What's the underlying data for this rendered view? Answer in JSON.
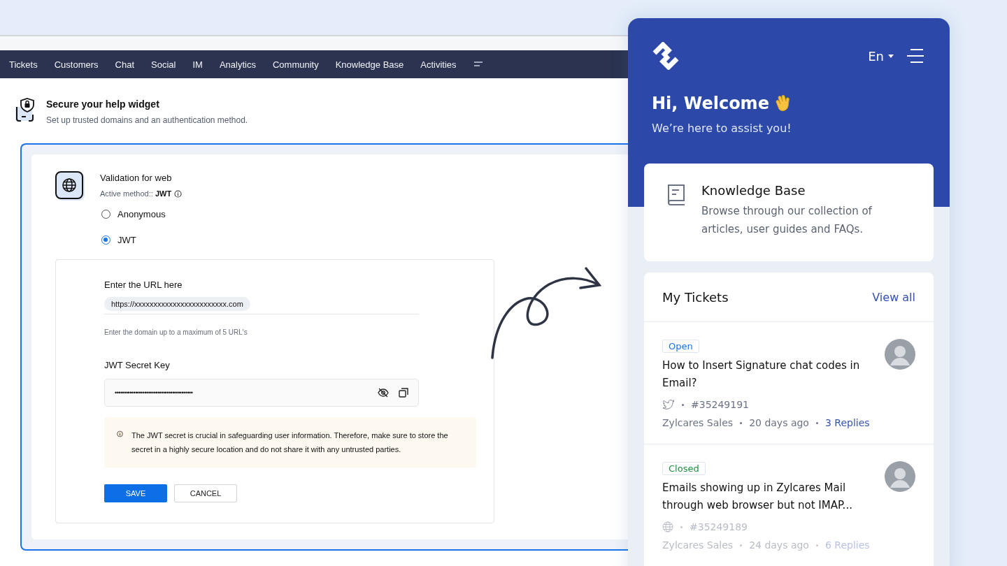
{
  "nav": {
    "items": [
      {
        "label": "Tickets"
      },
      {
        "label": "Customers"
      },
      {
        "label": "Chat"
      },
      {
        "label": "Social"
      },
      {
        "label": "IM"
      },
      {
        "label": "Analytics"
      },
      {
        "label": "Community"
      },
      {
        "label": "Knowledge Base"
      },
      {
        "label": "Activities"
      }
    ]
  },
  "header": {
    "title": "Secure your help widget",
    "subtitle": "Set up trusted domains and an authentication method."
  },
  "validation": {
    "title": "Validation for web",
    "active_method": "Active method:: **JWT**",
    "options": [
      {
        "label": "Anonymous",
        "selected": false
      },
      {
        "label": "JWT",
        "selected": true
      }
    ],
    "url_field": {
      "label": "Enter the URL here",
      "value": "https://xxxxxxxxxxxxxxxxxxxxxxxx.com",
      "hint": "Enter the domain up to a maximum of 5 URL's"
    },
    "secret_field": {
      "label": "JWT Secret Key",
      "value": "••••••••••••••••••••••••••••••••••••••••••"
    },
    "notice": "The JWT secret is crucial in safeguarding user information. Therefore, make sure to store the secret in a highly secure location and do not share it with any untrusted parties.",
    "buttons": [
      {
        "label": "SAVE",
        "kind": "primary"
      },
      {
        "label": "CANCEL",
        "kind": "secondary"
      }
    ]
  },
  "widget": {
    "language": "En",
    "greeting": "Hi, Welcome",
    "tagline": "We’re here to assist you!",
    "knowledge_base": {
      "title": "Knowledge Base",
      "description": "Browse through our collection of articles, user guides and FAQs."
    },
    "tickets": {
      "title": "My Tickets",
      "view_all": "View all",
      "items": [
        {
          "status": {
            "label": "Open",
            "kind": "open"
          },
          "subject": "How to Insert Signature chat codes in Email?",
          "channel": {
            "kind": "twitter"
          },
          "number": "#35249191",
          "agent": "Zylcares Sales",
          "age": "20 days ago",
          "replies": "3 Replies"
        },
        {
          "status": {
            "label": "Closed",
            "kind": "closed"
          },
          "subject": "Emails showing up in Zylcares Mail through web browser but not IMAP...",
          "channel": {
            "kind": "web"
          },
          "number": "#35249189",
          "agent": "Zylcares Sales",
          "age": "24 days ago",
          "replies": "6 Replies"
        }
      ]
    }
  }
}
